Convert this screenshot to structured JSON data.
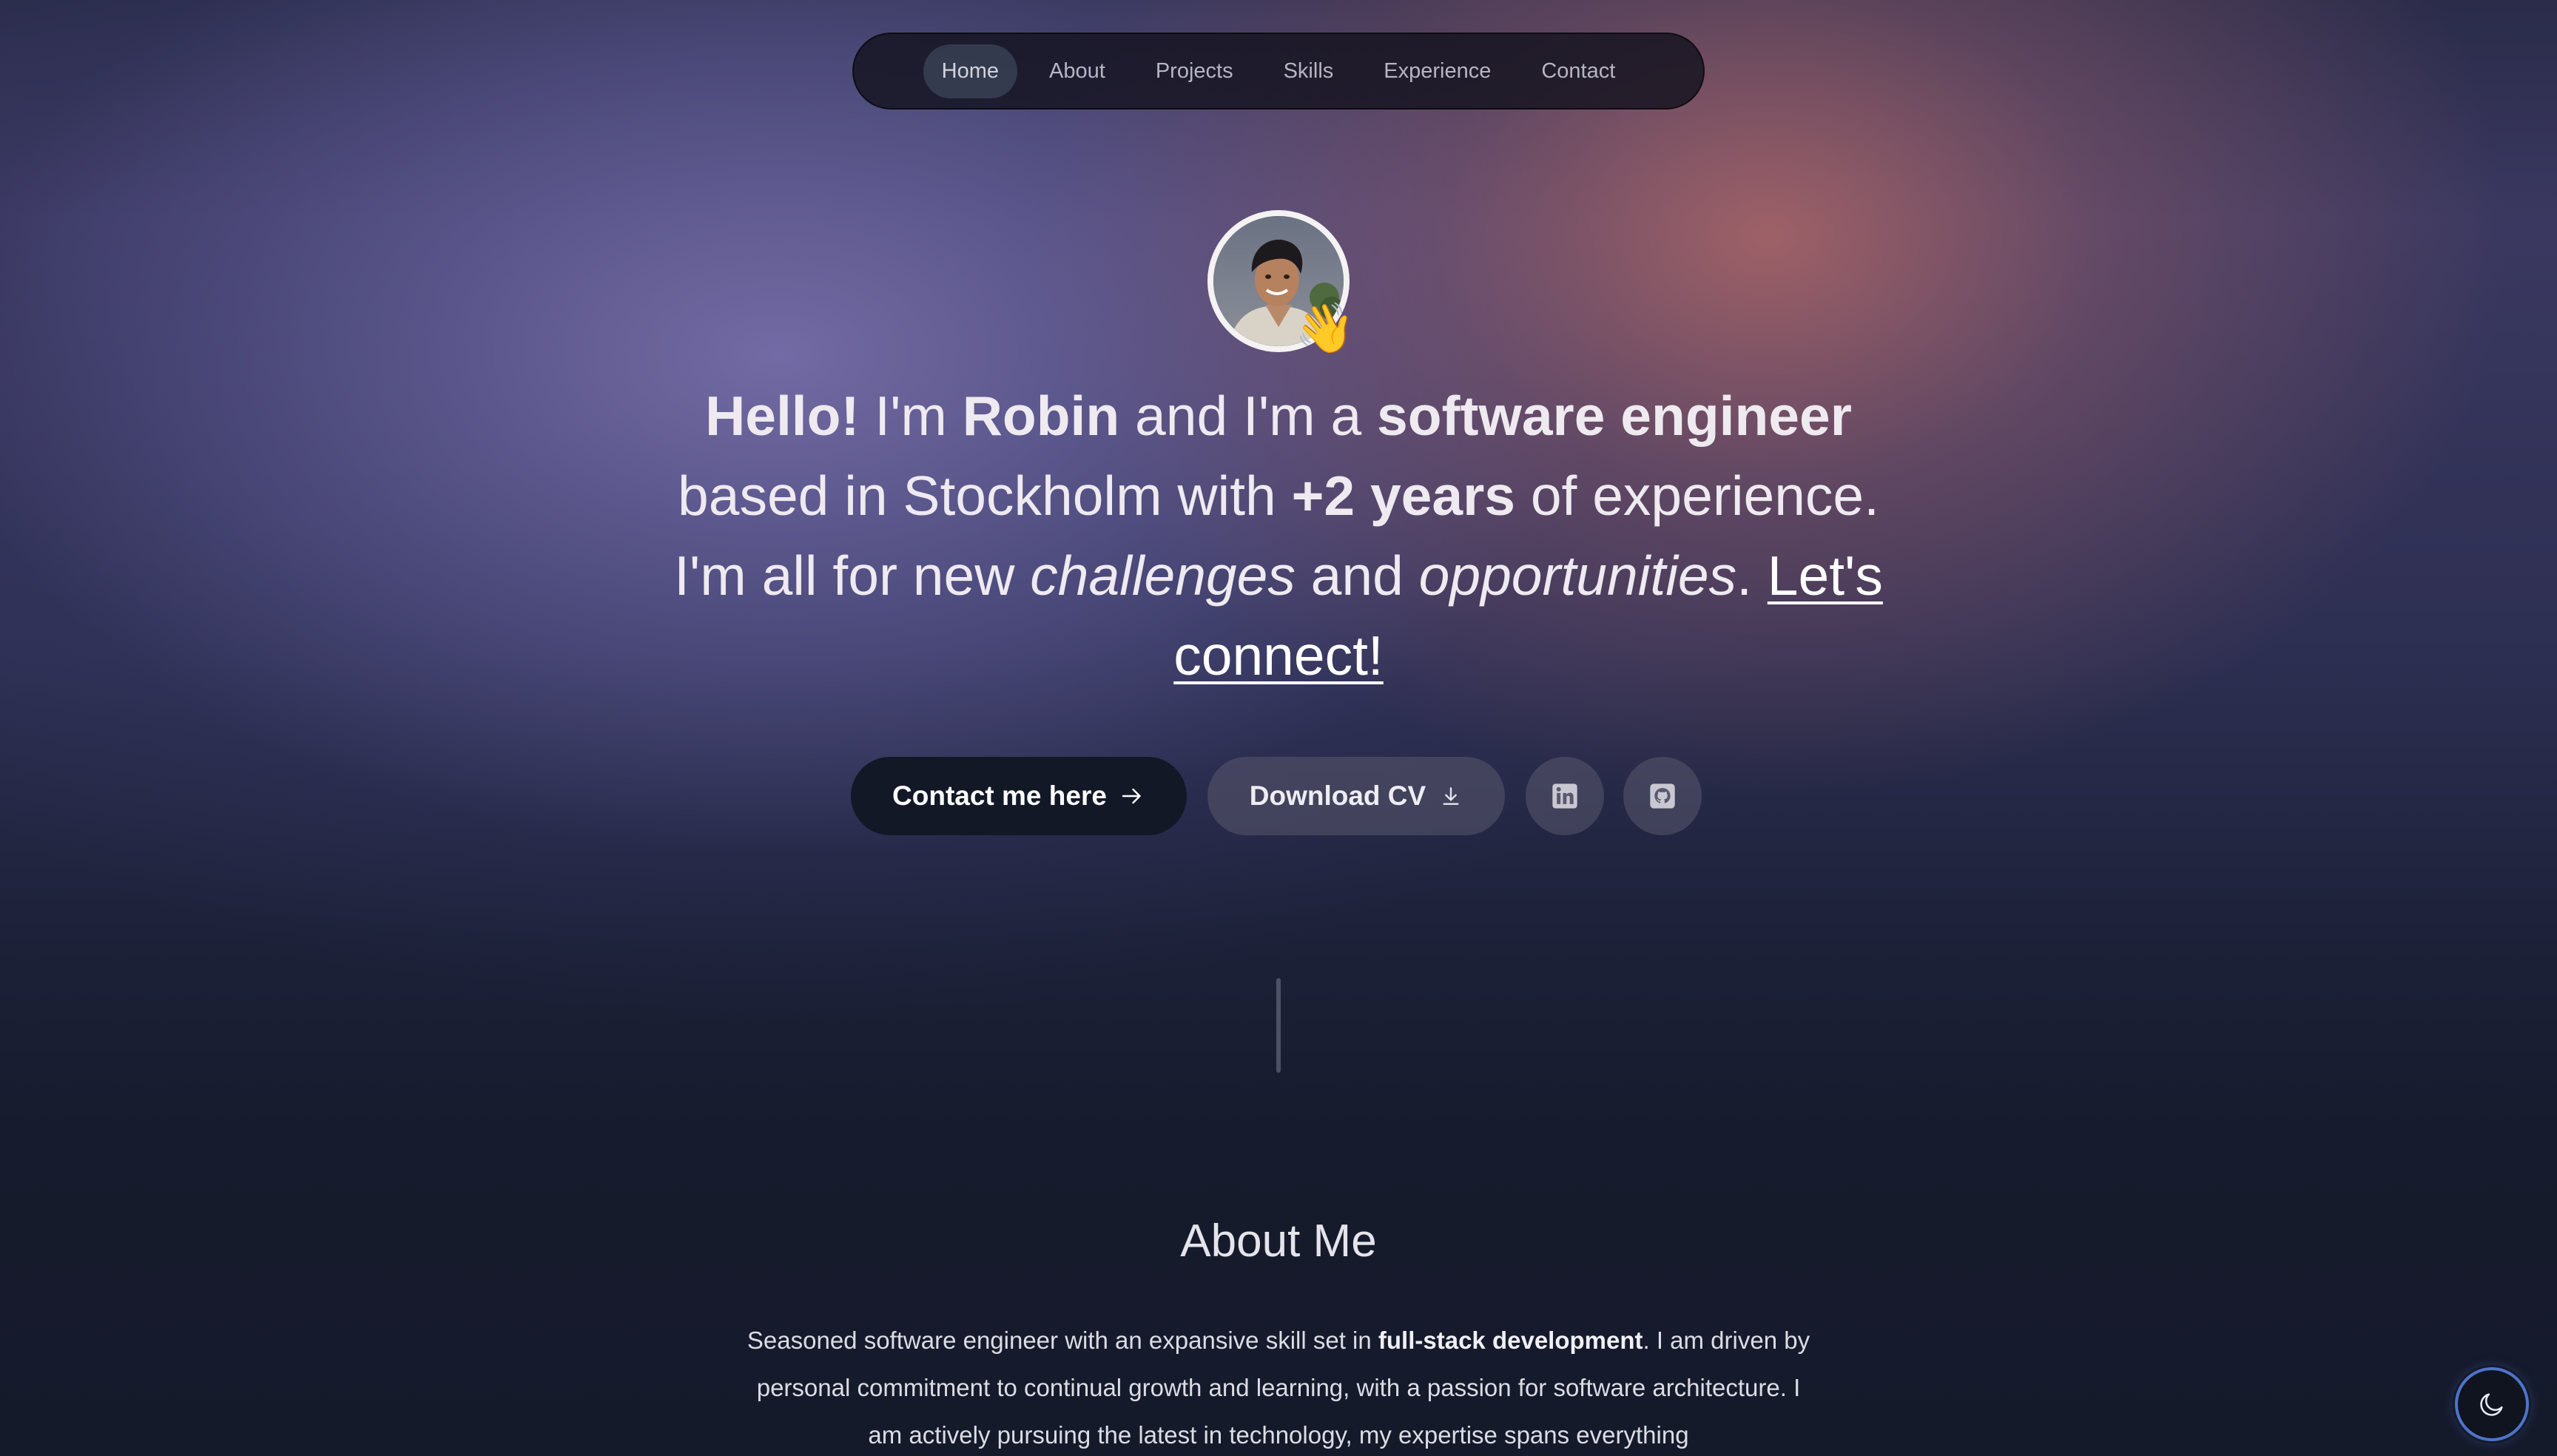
{
  "nav": {
    "items": [
      {
        "label": "Home",
        "active": true
      },
      {
        "label": "About",
        "active": false
      },
      {
        "label": "Projects",
        "active": false
      },
      {
        "label": "Skills",
        "active": false
      },
      {
        "label": "Experience",
        "active": false
      },
      {
        "label": "Contact",
        "active": false
      }
    ]
  },
  "hero": {
    "wave_emoji": "👋",
    "headline": {
      "hello": "Hello!",
      "im": " I'm ",
      "name": "Robin",
      "and_im_a": " and I'm a ",
      "role": "software engineer",
      "based_in": " based in Stockholm with ",
      "years": "+2 years",
      "of_experience": " of experience. I'm all for new ",
      "challenges": "challenges",
      "and": " and ",
      "opportunities": "opportunities",
      "period": ". ",
      "connect": "Let's connect!"
    },
    "buttons": {
      "contact_label": "Contact me here",
      "download_label": "Download CV",
      "linkedin_icon": "linkedin-icon",
      "github_icon": "github-icon"
    }
  },
  "about": {
    "title": "About Me",
    "text_before": "Seasoned software engineer with an expansive skill set in ",
    "text_bold": "full-stack development",
    "text_after": ". I am driven by personal commitment to continual growth and learning, with a passion for software architecture. I am actively pursuing the latest in technology, my expertise spans everything"
  },
  "theme_toggle": {
    "icon": "moon-icon"
  },
  "colors": {
    "nav_bg": "#14121e",
    "primary_button": "#131827",
    "toggle_border": "#4d74c8",
    "page_bg": "#151a2c"
  }
}
